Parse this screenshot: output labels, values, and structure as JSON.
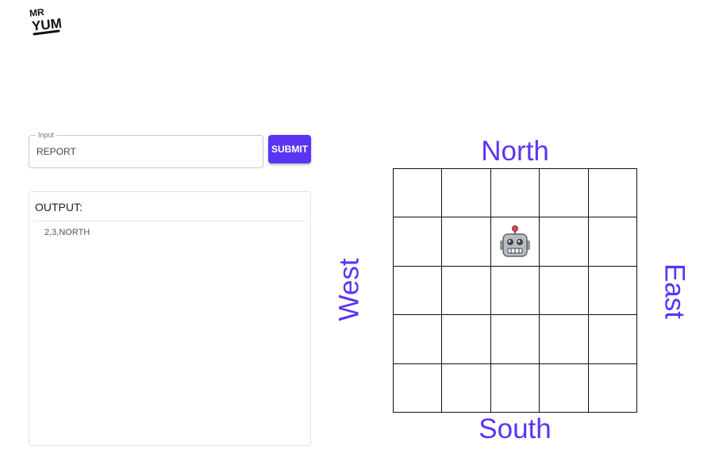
{
  "brand": {
    "logo_text": "MR YUM",
    "logo_icon": "mr-yum-logo"
  },
  "command": {
    "label": "Input",
    "value": "REPORT",
    "submit_label": "SUBMIT"
  },
  "output": {
    "title": "OUTPUT:",
    "lines": [
      "2,3,NORTH"
    ]
  },
  "board": {
    "labels": {
      "north": "North",
      "south": "South",
      "east": "East",
      "west": "West"
    },
    "size": 5,
    "robot": {
      "x": 2,
      "y": 3,
      "facing": "NORTH",
      "icon": "robot-icon"
    },
    "accent_color": "#5b34f5"
  }
}
